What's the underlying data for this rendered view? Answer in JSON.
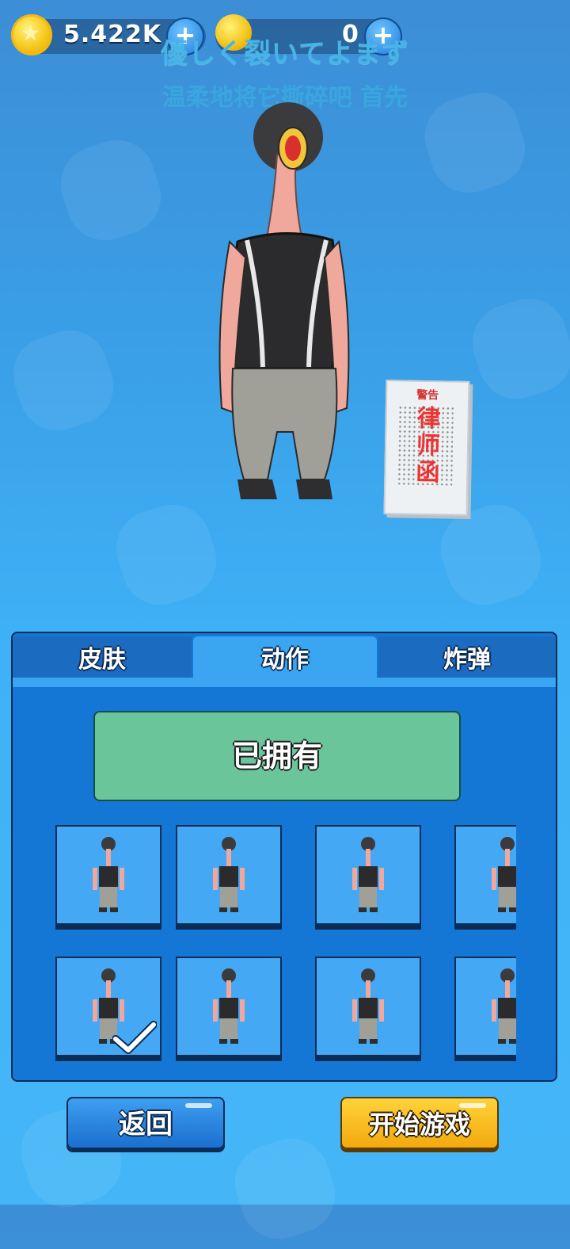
{
  "header": {
    "coins": "5.422K",
    "gems": "0",
    "plus_symbol": "+",
    "title_jp": "優しく裂いてよまず",
    "title_cn": "温柔地将它撕碎吧 首先"
  },
  "prop": {
    "top_text": "警告",
    "main_text": "律师函"
  },
  "tabs": [
    {
      "label": "皮肤",
      "active": false
    },
    {
      "label": "动作",
      "active": true
    },
    {
      "label": "炸弹",
      "active": false
    }
  ],
  "owned_label": "已拥有",
  "items_rows": 2,
  "items_cols_visible": 4,
  "selected_item_index": 4,
  "buttons": {
    "back": "返回",
    "start": "开始游戏"
  },
  "colors": {
    "panel_blue": "#1477d6",
    "tab_active": "#3aa6f2",
    "owned_green": "#6bc59a",
    "start_yellow": "#f2a90e"
  }
}
